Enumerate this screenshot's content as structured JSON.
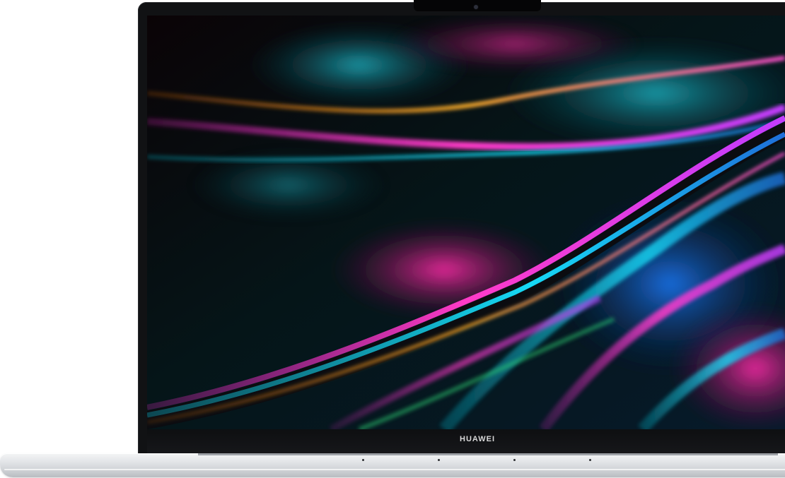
{
  "device": {
    "brand_label": "HUAWEI",
    "type": "laptop",
    "colors": {
      "bezel": "#111214",
      "body": "#e3e5e8",
      "wallpaper_accents": [
        "#ff2bd6",
        "#16d9f5",
        "#ff9a1a",
        "#1e6fd9",
        "#2ee07a"
      ]
    },
    "icons": [
      "camera-icon",
      "speaker-dot-icon"
    ]
  }
}
